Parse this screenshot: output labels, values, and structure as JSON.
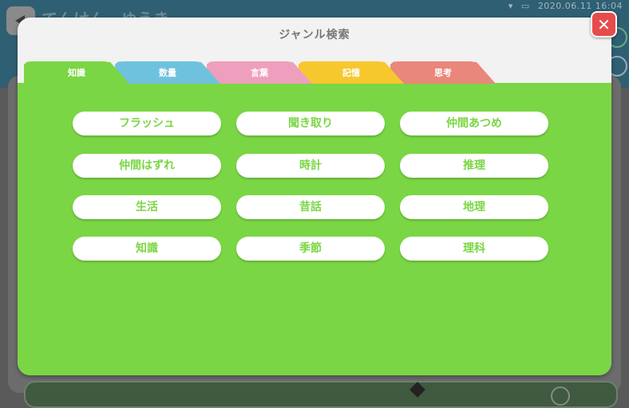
{
  "background": {
    "status_time": "2020.06.11  16:04",
    "app_title": "てんけん　ゆうき"
  },
  "modal": {
    "title": "ジャンル検索",
    "close_label": "✕"
  },
  "tabs": [
    {
      "label": "知識"
    },
    {
      "label": "数量"
    },
    {
      "label": "言葉"
    },
    {
      "label": "記憶"
    },
    {
      "label": "思考"
    }
  ],
  "genres": [
    {
      "label": "フラッシュ"
    },
    {
      "label": "聞き取り"
    },
    {
      "label": "仲間あつめ"
    },
    {
      "label": "仲間はずれ"
    },
    {
      "label": "時計"
    },
    {
      "label": "推理"
    },
    {
      "label": "生活"
    },
    {
      "label": "昔話"
    },
    {
      "label": "地理"
    },
    {
      "label": "知識"
    },
    {
      "label": "季節"
    },
    {
      "label": "理科"
    }
  ],
  "colors": {
    "active_tab": "#7ad644",
    "tab_quantity": "#6fc2de",
    "tab_words": "#ee9fbd",
    "tab_memory": "#f7c72e",
    "tab_thinking": "#e9877a",
    "close": "#e74c4c"
  }
}
